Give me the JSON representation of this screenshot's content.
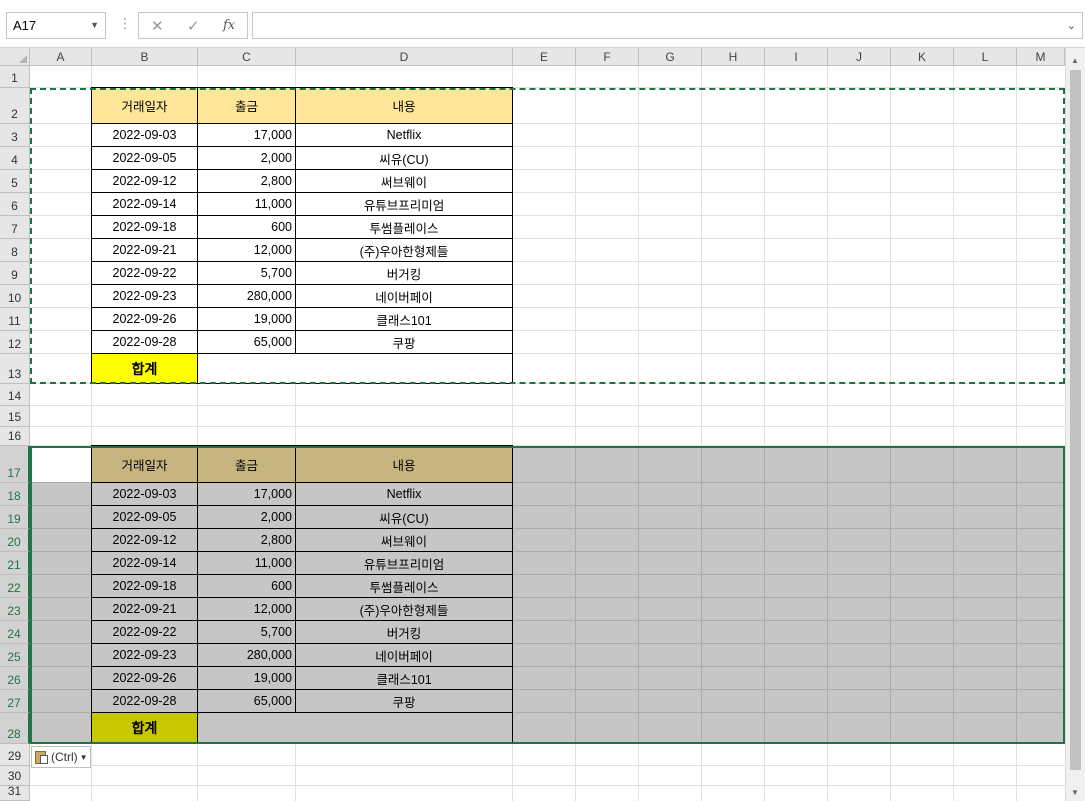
{
  "formula_bar": {
    "name_box": "A17",
    "cancel_icon": "✕",
    "enter_icon": "✓",
    "fx_label": "fx",
    "formula": ""
  },
  "columns": [
    "A",
    "B",
    "C",
    "D",
    "E",
    "F",
    "G",
    "H",
    "I",
    "J",
    "K",
    "L",
    "M"
  ],
  "rows": [
    "1",
    "2",
    "3",
    "4",
    "5",
    "6",
    "7",
    "8",
    "9",
    "10",
    "11",
    "12",
    "13",
    "14",
    "15",
    "16",
    "17",
    "18",
    "19",
    "20",
    "21",
    "22",
    "23",
    "24",
    "25",
    "26",
    "27",
    "28",
    "29",
    "30",
    "31"
  ],
  "table1": {
    "headers": [
      "거래일자",
      "출금",
      "내용"
    ],
    "rows": [
      [
        "2022-09-03",
        "17,000",
        "Netflix"
      ],
      [
        "2022-09-05",
        "2,000",
        "씨유(CU)"
      ],
      [
        "2022-09-12",
        "2,800",
        "써브웨이"
      ],
      [
        "2022-09-14",
        "11,000",
        "유튜브프리미엄"
      ],
      [
        "2022-09-18",
        "600",
        "투썸플레이스"
      ],
      [
        "2022-09-21",
        "12,000",
        "(주)우아한형제들"
      ],
      [
        "2022-09-22",
        "5,700",
        "버거킹"
      ],
      [
        "2022-09-23",
        "280,000",
        "네이버페이"
      ],
      [
        "2022-09-26",
        "19,000",
        "클래스101"
      ],
      [
        "2022-09-28",
        "65,000",
        "쿠팡"
      ]
    ],
    "total_label": "합계"
  },
  "table2": {
    "headers": [
      "거래일자",
      "출금",
      "내용"
    ],
    "rows": [
      [
        "2022-09-03",
        "17,000",
        "Netflix"
      ],
      [
        "2022-09-05",
        "2,000",
        "씨유(CU)"
      ],
      [
        "2022-09-12",
        "2,800",
        "써브웨이"
      ],
      [
        "2022-09-14",
        "11,000",
        "유튜브프리미엄"
      ],
      [
        "2022-09-18",
        "600",
        "투썸플레이스"
      ],
      [
        "2022-09-21",
        "12,000",
        "(주)우아한형제들"
      ],
      [
        "2022-09-22",
        "5,700",
        "버거킹"
      ],
      [
        "2022-09-23",
        "280,000",
        "네이버페이"
      ],
      [
        "2022-09-26",
        "19,000",
        "클래스101"
      ],
      [
        "2022-09-28",
        "65,000",
        "쿠팡"
      ]
    ],
    "total_label": "합계"
  },
  "paste_options": {
    "label": "(Ctrl)"
  },
  "colors": {
    "header1": "#ffe699",
    "total1": "#ffff00",
    "header2": "#c6b57e",
    "total2": "#c8c800",
    "selection_shade": "#c6c6c6",
    "accent": "#217346"
  }
}
